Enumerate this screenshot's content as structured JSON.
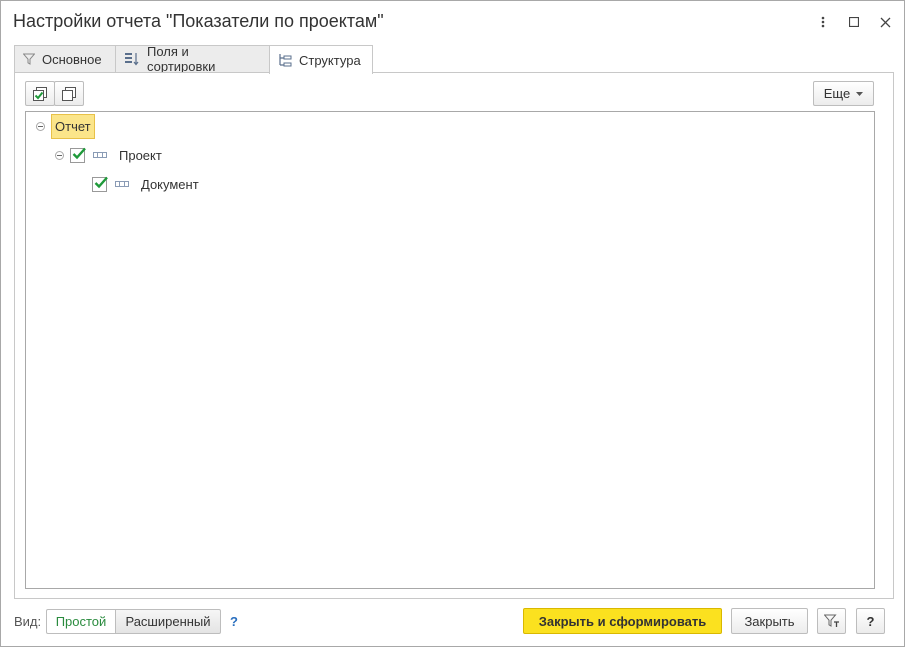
{
  "window": {
    "title": "Настройки отчета \"Показатели по проектам\"",
    "menu_icon": "more-vertical-icon",
    "maximize_icon": "maximize-icon",
    "close_icon": "close-icon"
  },
  "tabs": [
    {
      "label": "Основное",
      "icon": "filter-icon",
      "active": false
    },
    {
      "label": "Поля и сортировки",
      "icon": "fields-sort-icon",
      "active": false
    },
    {
      "label": "Структура",
      "icon": "structure-icon",
      "active": true
    }
  ],
  "toolbar": {
    "check_all_icon": "check-all-icon",
    "uncheck_all_icon": "uncheck-all-icon",
    "more_label": "Еще"
  },
  "tree": {
    "root": {
      "label": "Отчет",
      "expanded": true
    },
    "items": [
      {
        "label": "Проект",
        "checked": true,
        "expanded": true,
        "level": 1
      },
      {
        "label": "Документ",
        "checked": true,
        "expanded": false,
        "level": 2
      }
    ]
  },
  "footer": {
    "view_label": "Вид:",
    "simple_label": "Простой",
    "advanced_label": "Расширенный",
    "help_label": "?",
    "generate_label": "Закрыть и сформировать",
    "close_label": "Закрыть",
    "filter_icon": "filter-settings-icon",
    "help_button_label": "?"
  },
  "colors": {
    "primary_button": "#fbe11f",
    "selected_root": "#fbe58a",
    "active_view": "#2a8b3e",
    "check": "#1f9a3a"
  }
}
